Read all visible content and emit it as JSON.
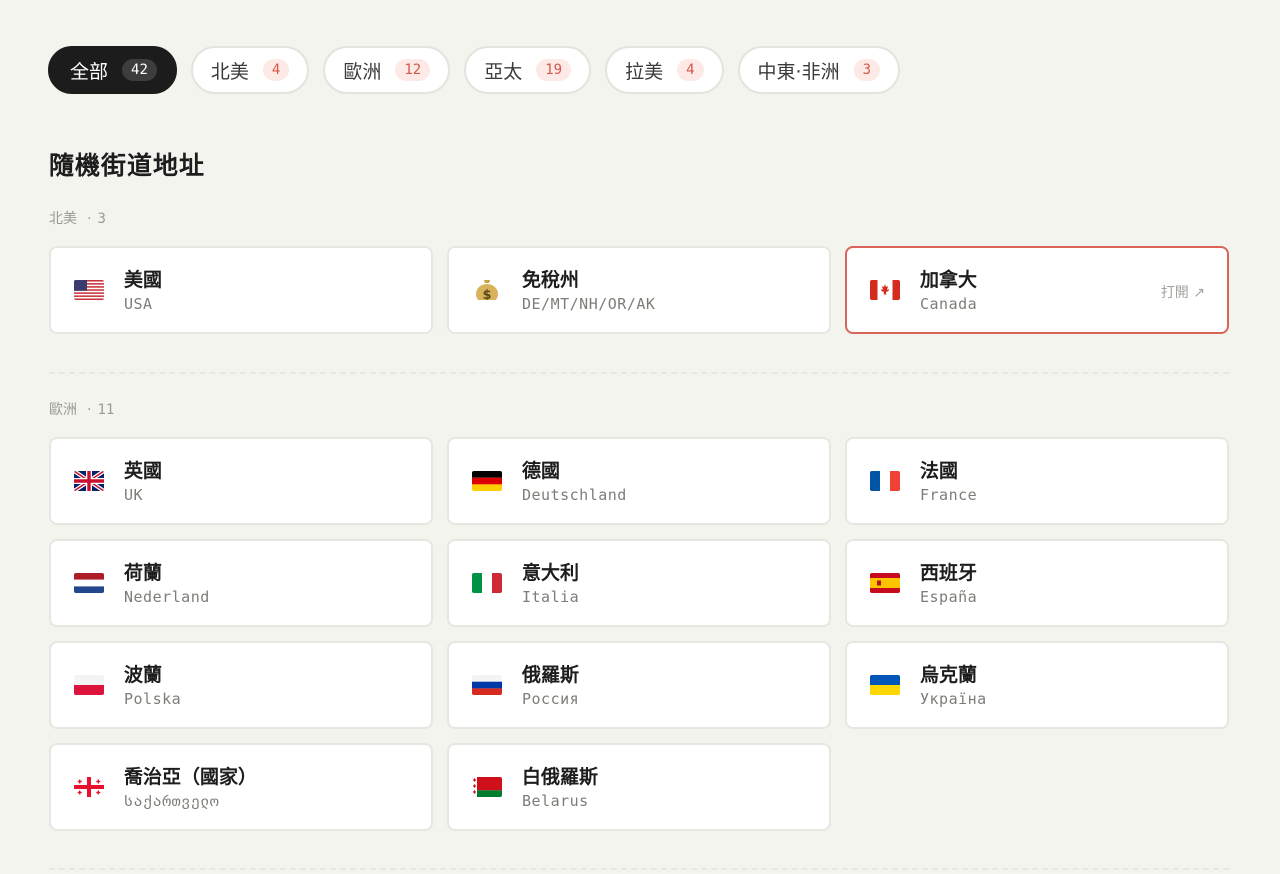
{
  "filters": [
    {
      "label": "全部",
      "count": "42"
    },
    {
      "label": "北美",
      "count": "4"
    },
    {
      "label": "歐洲",
      "count": "12"
    },
    {
      "label": "亞太",
      "count": "19"
    },
    {
      "label": "拉美",
      "count": "4"
    },
    {
      "label": "中東·非洲",
      "count": "3"
    }
  ],
  "page_title": "隨機街道地址",
  "sections": [
    {
      "name": "北美",
      "sep": "·",
      "count": "3",
      "items": [
        {
          "cn": "美國",
          "en": "USA",
          "icon": "flag-usa"
        },
        {
          "cn": "免稅州",
          "en": "DE/MT/NH/OR/AK",
          "icon": "money-bag"
        },
        {
          "cn": "加拿大",
          "en": "Canada",
          "icon": "flag-canada",
          "open_label": "打開 ↗"
        }
      ]
    },
    {
      "name": "歐洲",
      "sep": "·",
      "count": "11",
      "items": [
        {
          "cn": "英國",
          "en": "UK",
          "icon": "flag-uk"
        },
        {
          "cn": "德國",
          "en": "Deutschland",
          "icon": "flag-germany"
        },
        {
          "cn": "法國",
          "en": "France",
          "icon": "flag-france"
        },
        {
          "cn": "荷蘭",
          "en": "Nederland",
          "icon": "flag-netherlands"
        },
        {
          "cn": "意大利",
          "en": "Italia",
          "icon": "flag-italy"
        },
        {
          "cn": "西班牙",
          "en": "España",
          "icon": "flag-spain"
        },
        {
          "cn": "波蘭",
          "en": "Polska",
          "icon": "flag-poland"
        },
        {
          "cn": "俄羅斯",
          "en": "Россия",
          "icon": "flag-russia"
        },
        {
          "cn": "烏克蘭",
          "en": "Україна",
          "icon": "flag-ukraine"
        },
        {
          "cn": "喬治亞（國家）",
          "en": "საქართველო",
          "icon": "flag-georgia"
        },
        {
          "cn": "白俄羅斯",
          "en": "Belarus",
          "icon": "flag-belarus"
        }
      ]
    }
  ],
  "colors": {
    "accent": "#d9655a",
    "badge_text": "#d5574a",
    "badge_bg": "#fde9e5",
    "active_pill": "#1c1c1c"
  }
}
